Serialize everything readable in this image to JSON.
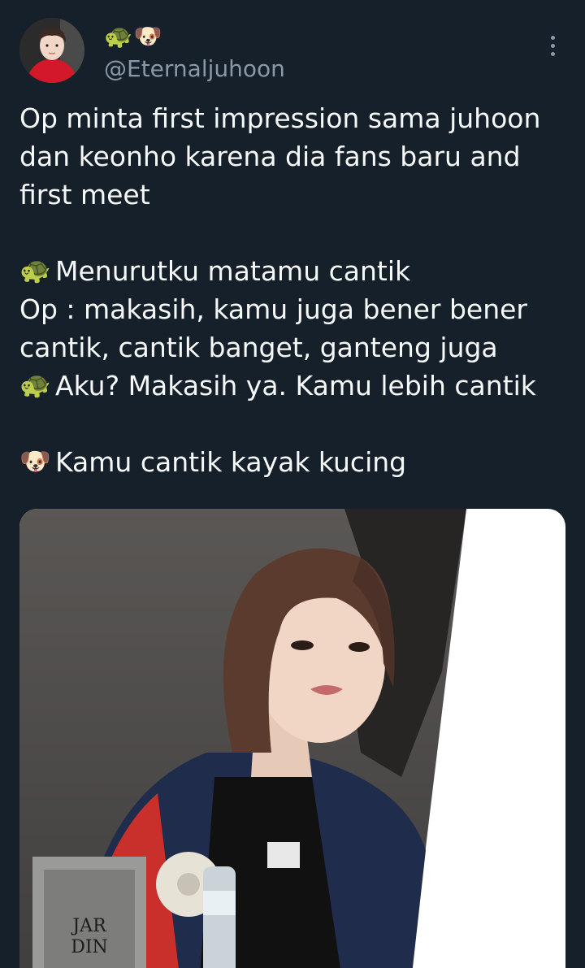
{
  "tweet": {
    "display_name": "🐢🐶",
    "handle": "@Eternaljuhoon",
    "lines": [
      {
        "emoji": "",
        "text": "Op minta first impression sama juhoon"
      },
      {
        "emoji": "",
        "text": "dan keonho karena dia fans baru and"
      },
      {
        "emoji": "",
        "text": "first meet"
      },
      {
        "emoji": "",
        "text": ""
      },
      {
        "emoji": "🐢",
        "text": "Menurutku matamu cantik"
      },
      {
        "emoji": "",
        "text": "Op : makasih, kamu juga bener bener"
      },
      {
        "emoji": "",
        "text": "cantik, cantik banget, ganteng juga"
      },
      {
        "emoji": "🐢",
        "text": "Aku? Makasih ya. Kamu lebih cantik"
      },
      {
        "emoji": "",
        "text": ""
      },
      {
        "emoji": "🐶",
        "text": "Kamu cantik kayak kucing"
      }
    ],
    "media": {
      "desk_sign": {
        "line1": "JAR",
        "line2": "DIN"
      }
    }
  },
  "icons": {
    "more": "more-vertical-icon"
  }
}
